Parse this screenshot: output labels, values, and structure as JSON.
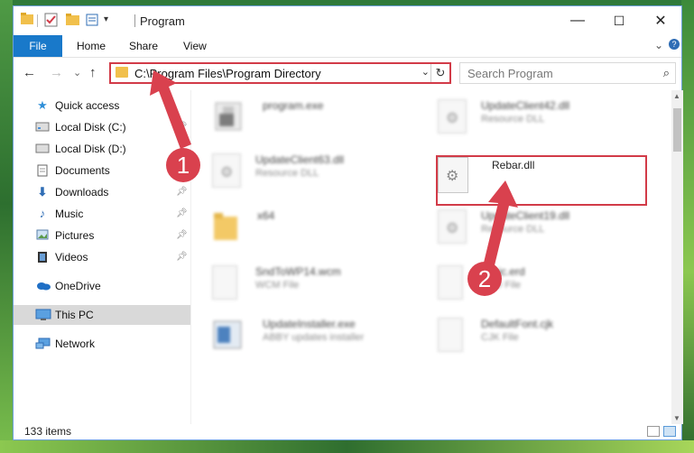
{
  "window": {
    "title": "Program",
    "controls": {
      "minimize": "—",
      "maximize": "☐",
      "close": "✕"
    }
  },
  "ribbon": {
    "tabs": [
      "File",
      "Home",
      "Share",
      "View"
    ],
    "collapse": "⌄",
    "help": "?"
  },
  "navigation": {
    "back": "←",
    "forward": "→",
    "recent": "⌄",
    "up": "↑"
  },
  "address": {
    "path": "C:\\Program Files\\Program Directory",
    "dropdown": "⌄",
    "refresh": "↻"
  },
  "search": {
    "placeholder": "Search Program",
    "icon": "⌕"
  },
  "sidebar": {
    "items": [
      {
        "label": "Quick access",
        "icon": "star-icon",
        "pinned": false
      },
      {
        "label": "Local Disk (C:)",
        "icon": "drive-icon",
        "pinned": true
      },
      {
        "label": "Local Disk (D:)",
        "icon": "drive-icon",
        "pinned": false
      },
      {
        "label": "Documents",
        "icon": "documents-icon",
        "pinned": false
      },
      {
        "label": "Downloads",
        "icon": "download-icon",
        "pinned": true
      },
      {
        "label": "Music",
        "icon": "music-icon",
        "pinned": true
      },
      {
        "label": "Pictures",
        "icon": "pictures-icon",
        "pinned": true
      },
      {
        "label": "Videos",
        "icon": "videos-icon",
        "pinned": true
      },
      {
        "label": "OneDrive",
        "icon": "cloud-icon",
        "pinned": false
      },
      {
        "label": "This PC",
        "icon": "computer-icon",
        "pinned": false,
        "selected": true
      },
      {
        "label": "Network",
        "icon": "network-icon",
        "pinned": false
      }
    ]
  },
  "files": [
    {
      "name": "program.exe",
      "type": "",
      "kind": "exe",
      "blurred": true
    },
    {
      "name": "UpdateClient42.dll",
      "type": "Resource DLL",
      "kind": "dll",
      "blurred": true
    },
    {
      "name": "UpdateClient63.dll",
      "type": "Resource DLL",
      "kind": "dll",
      "blurred": true
    },
    {
      "name": "Rebar.dll",
      "type": "",
      "kind": "dll",
      "blurred": false,
      "highlighted": true
    },
    {
      "name": "x64",
      "type": "",
      "kind": "folder",
      "blurred": true
    },
    {
      "name": "UpdateClient19.dll",
      "type": "Resource DLL",
      "kind": "dll",
      "blurred": true
    },
    {
      "name": "SndToWP14.wcm",
      "type": "WCM File",
      "kind": "doc",
      "blurred": true
    },
    {
      "name": "basic.erd",
      "type": "ERD File",
      "kind": "doc",
      "blurred": true
    },
    {
      "name": "UpdateInstaller.exe",
      "type": "ABBY updates installer",
      "kind": "installer",
      "blurred": true
    },
    {
      "name": "DefaultFont.cjk",
      "type": "CJK File",
      "kind": "doc",
      "blurred": true
    }
  ],
  "status": {
    "item_count": "133 items"
  },
  "annotations": {
    "step1": "1",
    "step2": "2"
  },
  "colors": {
    "accent": "#1979ca",
    "highlight": "#d23b48",
    "folder": "#f1c04c"
  }
}
